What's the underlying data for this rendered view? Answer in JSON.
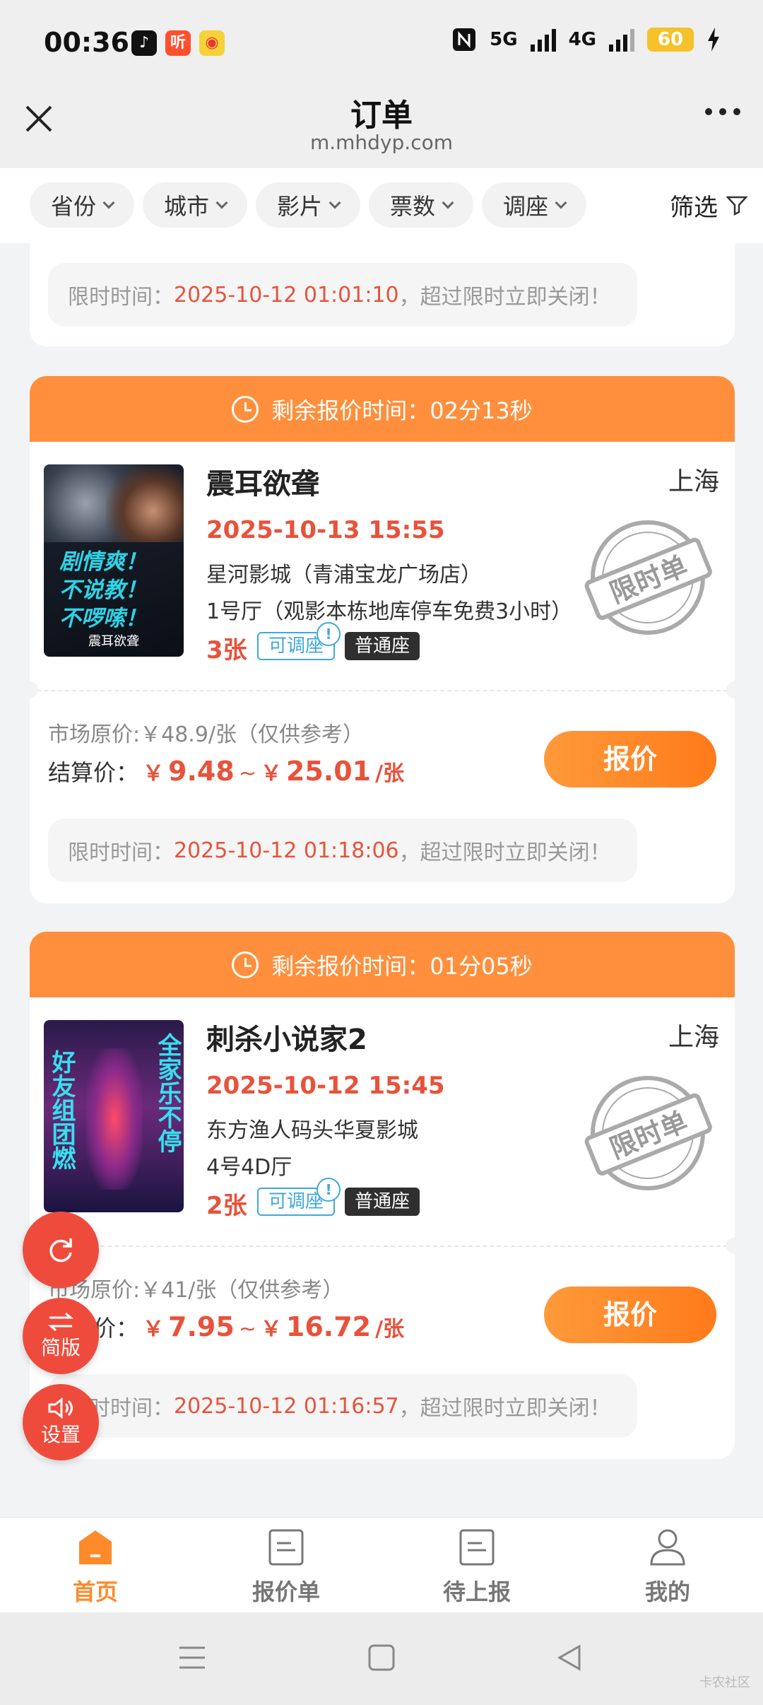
{
  "status_bar": {
    "time": "00:36",
    "app1": "♪",
    "app2": "听",
    "app3": "◉",
    "net1": "5G",
    "net2": "4G",
    "battery": "60"
  },
  "title_bar": {
    "title": "订单",
    "url": "m.mhdyp.com"
  },
  "filters": {
    "chips": [
      "省份",
      "城市",
      "影片",
      "票数",
      "调座"
    ],
    "filter_label": "筛选"
  },
  "top_card": {
    "limit_label": "限时时间：",
    "limit_time": "2025-10-12 01:01:10",
    "limit_suffix": "，超过限时立即关闭！"
  },
  "orders": [
    {
      "countdown_label": "剩余报价时间：",
      "countdown": "02分13秒",
      "movie": "震耳欲聋",
      "city": "上海",
      "showtime": "2025-10-13 15:55",
      "cinema": "星河影城（青浦宝龙广场店）",
      "hall": "1号厅（观影本栋地库停车免费3小时）",
      "count": "3张",
      "tag_adjustable": "可调座",
      "tag_seat": "普通座",
      "stamp_text": "限时单",
      "market_price": "市场原价:￥48.9/张（仅供参考）",
      "settle_label": "结算价：",
      "price_low": "9.48",
      "price_high": "25.01",
      "price_unit": "/张",
      "quote_button": "报价",
      "limit_label": "限时时间：",
      "limit_time": "2025-10-12 01:18:06",
      "limit_suffix": "，超过限时立即关闭！",
      "poster_text": [
        "剧情爽！",
        "不说教！",
        "不啰嗦！"
      ],
      "poster_title": "震耳欲聋"
    },
    {
      "countdown_label": "剩余报价时间：",
      "countdown": "01分05秒",
      "movie": "刺杀小说家2",
      "city": "上海",
      "showtime": "2025-10-12 15:45",
      "cinema": "东方渔人码头华夏影城",
      "hall": "4号4D厅",
      "count": "2张",
      "tag_adjustable": "可调座",
      "tag_seat": "普通座",
      "stamp_text": "限时单",
      "market_price": "市场原价:￥41/张（仅供参考）",
      "settle_label": "结算价：",
      "price_low": "7.95",
      "price_high": "16.72",
      "price_unit": "/张",
      "quote_button": "报价",
      "limit_label": "限时时间：",
      "limit_time": "2025-10-12 01:16:57",
      "limit_suffix": "，超过限时立即关闭！",
      "poster_text": [
        "好友组团燃",
        "全家乐不停"
      ]
    }
  ],
  "fabs": {
    "refresh": "",
    "simple_label": "简版",
    "settings_label": "设置"
  },
  "bottom_nav": [
    "首页",
    "报价单",
    "待上报",
    "我的"
  ],
  "watermark": "卡农社区",
  "colors": {
    "accent": "#ff8f3c",
    "price": "#e8523b",
    "fab": "#ef4b3c"
  }
}
